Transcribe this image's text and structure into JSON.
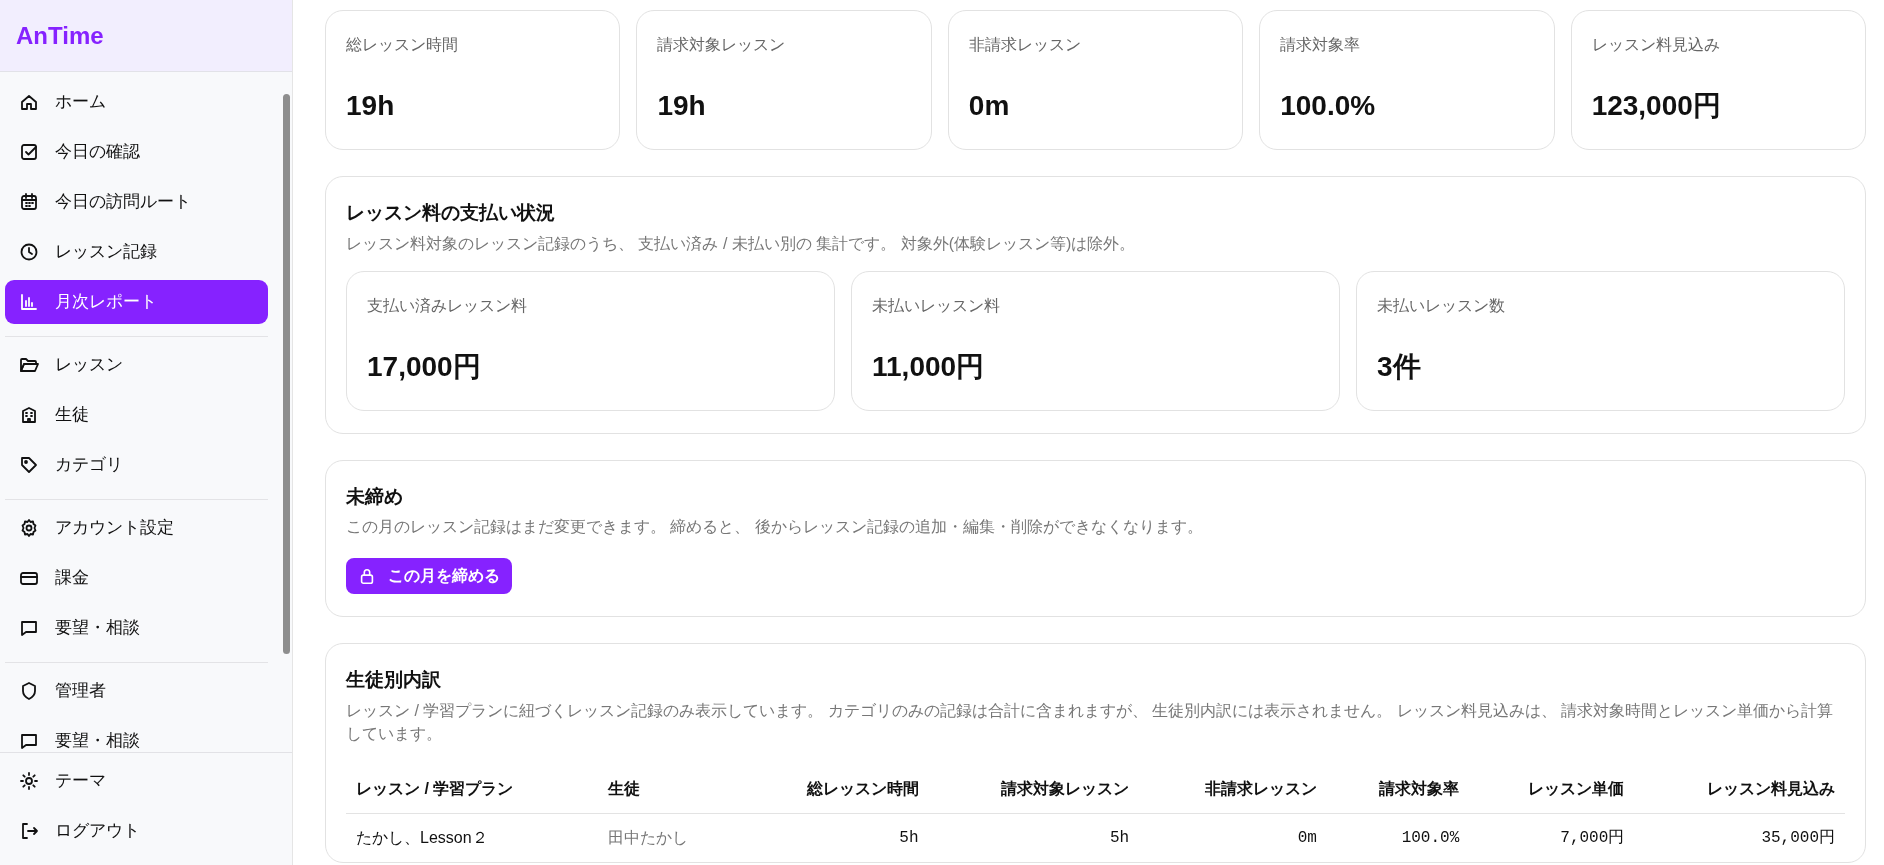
{
  "app": {
    "logo": "AnTime"
  },
  "sidebar": {
    "groups": [
      {
        "items": [
          {
            "label": "ホーム",
            "kind": "home",
            "selected": false
          },
          {
            "label": "今日の確認",
            "kind": "check",
            "selected": false
          },
          {
            "label": "今日の訪問ルート",
            "kind": "calendar",
            "selected": false
          },
          {
            "label": "レッスン記録",
            "kind": "clock",
            "selected": false
          },
          {
            "label": "月次レポート",
            "kind": "chart",
            "selected": true
          }
        ]
      },
      {
        "items": [
          {
            "label": "レッスン",
            "kind": "folder",
            "selected": false
          },
          {
            "label": "生徒",
            "kind": "building",
            "selected": false
          },
          {
            "label": "カテゴリ",
            "kind": "tag",
            "selected": false
          }
        ]
      },
      {
        "items": [
          {
            "label": "アカウント設定",
            "kind": "gear",
            "selected": false
          },
          {
            "label": "課金",
            "kind": "card",
            "selected": false
          },
          {
            "label": "要望・相談",
            "kind": "chat",
            "selected": false
          }
        ]
      },
      {
        "items": [
          {
            "label": "管理者",
            "kind": "shield",
            "selected": false
          },
          {
            "label": "要望・相談",
            "kind": "chat",
            "selected": false
          }
        ]
      }
    ],
    "footer": [
      {
        "label": "テーマ",
        "kind": "sun"
      },
      {
        "label": "ログアウト",
        "kind": "logout"
      }
    ]
  },
  "stats": [
    {
      "label": "総レッスン時間",
      "value": "19h"
    },
    {
      "label": "請求対象レッスン",
      "value": "19h"
    },
    {
      "label": "非請求レッスン",
      "value": "0m"
    },
    {
      "label": "請求対象率",
      "value": "100.0%"
    },
    {
      "label": "レッスン料見込み",
      "value": "123,000円"
    }
  ],
  "payment": {
    "title": "レッスン料の支払い状況",
    "description": "レッスン料対象のレッスン記録のうち、 支払い済み / 未払い別の 集計です。 対象外(体験レッスン等)は除外。",
    "cards": [
      {
        "label": "支払い済みレッスン料",
        "value": "17,000円"
      },
      {
        "label": "未払いレッスン料",
        "value": "11,000円"
      },
      {
        "label": "未払いレッスン数",
        "value": "3件"
      }
    ]
  },
  "closing": {
    "title": "未締め",
    "description": "この月のレッスン記録はまだ変更できます。 締めると、 後からレッスン記録の追加・編集・削除ができなくなります。",
    "button": "この月を締める"
  },
  "breakdown": {
    "title": "生徒別内訳",
    "description": "レッスン / 学習プランに紐づくレッスン記録のみ表示しています。 カテゴリのみの記録は合計に含まれますが、 生徒別内訳には表示されません。 レッスン料見込みは、 請求対象時間とレッスン単価から計算しています。",
    "table": {
      "columns": [
        "レッスン / 学習プラン",
        "生徒",
        "総レッスン時間",
        "請求対象レッスン",
        "非請求レッスン",
        "請求対象率",
        "レッスン単価",
        "レッスン料見込み"
      ],
      "rows": [
        [
          "たかし、Lesson２",
          "田中たかし",
          "5h",
          "5h",
          "0m",
          "100.0%",
          "7,000円",
          "35,000円"
        ]
      ]
    }
  }
}
